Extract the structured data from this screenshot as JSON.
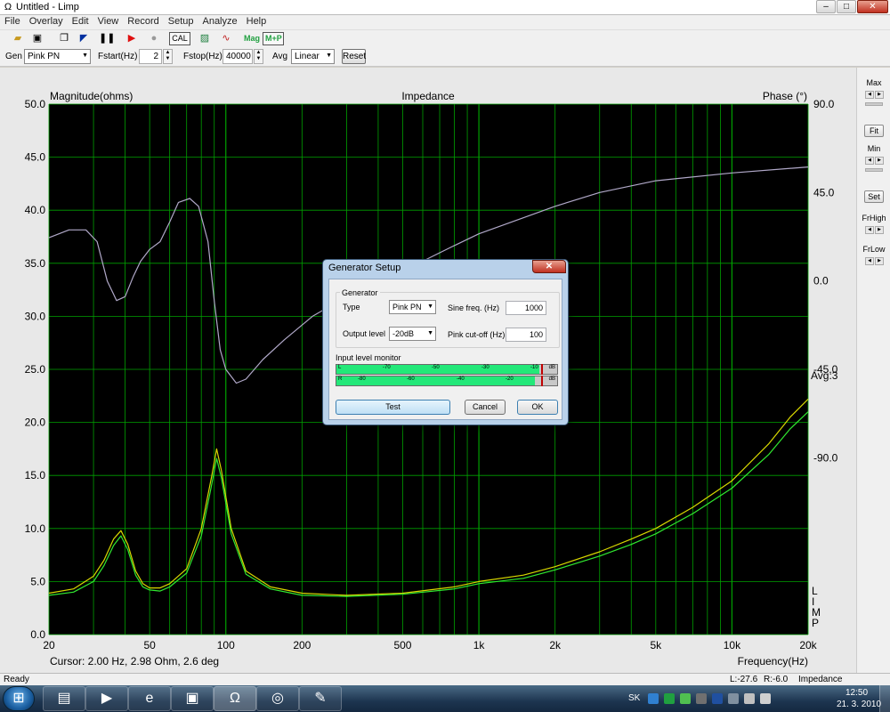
{
  "window": {
    "title": "Untitled - Limp",
    "app_icon": "omega-icon",
    "minimize": "–",
    "restore": "□",
    "close": "✕"
  },
  "menu": [
    "File",
    "Overlay",
    "Edit",
    "View",
    "Record",
    "Setup",
    "Analyze",
    "Help"
  ],
  "toolbar": {
    "cal": "CAL",
    "mag": "Mag",
    "mp": "M+P"
  },
  "genbar": {
    "gen_label": "Gen",
    "gen_value": "Pink PN",
    "fstart_label": "Fstart(Hz)",
    "fstart_value": "2",
    "fstop_label": "Fstop(Hz)",
    "fstop_value": "40000",
    "avg_label": "Avg",
    "avg_value": "Linear",
    "reset": "Reset"
  },
  "chart_data": {
    "type": "line",
    "title": "Impedance",
    "left_label": "Magnitude(ohms)",
    "right_label": "Phase (°)",
    "xlabel": "Frequency(Hz)",
    "x_scale": "log",
    "xlim": [
      20,
      20000
    ],
    "ylim": [
      0,
      50
    ],
    "y2lim": [
      -180,
      90
    ],
    "left_ticks": [
      "50.0",
      "45.0",
      "40.0",
      "35.0",
      "30.0",
      "25.0",
      "20.0",
      "15.0",
      "10.0",
      "5.0",
      "0.0"
    ],
    "right_ticks": [
      "90.0",
      "45.0",
      "0.0",
      "-45.0",
      "-90.0"
    ],
    "x_ticks": [
      {
        "v": 20,
        "t": "20"
      },
      {
        "v": 50,
        "t": "50"
      },
      {
        "v": 100,
        "t": "100"
      },
      {
        "v": 200,
        "t": "200"
      },
      {
        "v": 500,
        "t": "500"
      },
      {
        "v": 1000,
        "t": "1k"
      },
      {
        "v": 2000,
        "t": "2k"
      },
      {
        "v": 5000,
        "t": "5k"
      },
      {
        "v": 10000,
        "t": "10k"
      },
      {
        "v": 20000,
        "t": "20k"
      }
    ],
    "avg_text": "Avg:3",
    "limp_text": [
      "L",
      "I",
      "M",
      "P"
    ],
    "cursor_text": "Cursor: 2.00 Hz, 2.98 Ohm, 2.6 deg",
    "background": "#000000",
    "grid_color": "#00a000",
    "series": [
      {
        "color": "#d8d800",
        "axis": "left",
        "points": [
          [
            20,
            3.9
          ],
          [
            25,
            4.3
          ],
          [
            30,
            5.5
          ],
          [
            33,
            7.0
          ],
          [
            36,
            9.0
          ],
          [
            38.5,
            9.8
          ],
          [
            41,
            8.5
          ],
          [
            44,
            6.0
          ],
          [
            47,
            4.8
          ],
          [
            50,
            4.4
          ],
          [
            55,
            4.4
          ],
          [
            60,
            4.8
          ],
          [
            70,
            6.2
          ],
          [
            80,
            10.0
          ],
          [
            88,
            15.0
          ],
          [
            92,
            17.5
          ],
          [
            96,
            15.5
          ],
          [
            105,
            10.0
          ],
          [
            120,
            6.0
          ],
          [
            150,
            4.5
          ],
          [
            200,
            3.9
          ],
          [
            300,
            3.7
          ],
          [
            500,
            3.9
          ],
          [
            800,
            4.5
          ],
          [
            1000,
            5.0
          ],
          [
            1500,
            5.6
          ],
          [
            2000,
            6.4
          ],
          [
            3000,
            7.8
          ],
          [
            4000,
            9.0
          ],
          [
            5000,
            10.0
          ],
          [
            7000,
            12.0
          ],
          [
            10000,
            14.5
          ],
          [
            14000,
            18.0
          ],
          [
            17000,
            20.5
          ],
          [
            20000,
            22.2
          ]
        ]
      },
      {
        "color": "#30e830",
        "axis": "left",
        "points": [
          [
            20,
            3.7
          ],
          [
            25,
            4.0
          ],
          [
            30,
            5.0
          ],
          [
            33,
            6.5
          ],
          [
            36,
            8.4
          ],
          [
            38.5,
            9.3
          ],
          [
            41,
            8.0
          ],
          [
            44,
            5.6
          ],
          [
            47,
            4.5
          ],
          [
            50,
            4.2
          ],
          [
            55,
            4.1
          ],
          [
            60,
            4.5
          ],
          [
            70,
            5.8
          ],
          [
            80,
            9.3
          ],
          [
            88,
            14.2
          ],
          [
            92,
            16.6
          ],
          [
            96,
            14.8
          ],
          [
            105,
            9.5
          ],
          [
            120,
            5.7
          ],
          [
            150,
            4.3
          ],
          [
            200,
            3.7
          ],
          [
            300,
            3.6
          ],
          [
            500,
            3.8
          ],
          [
            800,
            4.3
          ],
          [
            1000,
            4.8
          ],
          [
            1500,
            5.3
          ],
          [
            2000,
            6.1
          ],
          [
            3000,
            7.4
          ],
          [
            4000,
            8.5
          ],
          [
            5000,
            9.5
          ],
          [
            7000,
            11.4
          ],
          [
            10000,
            13.8
          ],
          [
            14000,
            17.0
          ],
          [
            17000,
            19.4
          ],
          [
            20000,
            21.0
          ]
        ]
      },
      {
        "color": "#b0a8c8",
        "axis": "right",
        "points": [
          [
            20,
            22
          ],
          [
            24,
            26
          ],
          [
            28,
            26
          ],
          [
            31,
            20
          ],
          [
            34,
            0
          ],
          [
            37,
            -10
          ],
          [
            40,
            -8
          ],
          [
            43,
            2
          ],
          [
            46,
            10
          ],
          [
            50,
            16
          ],
          [
            55,
            20
          ],
          [
            60,
            30
          ],
          [
            65,
            40
          ],
          [
            72,
            42
          ],
          [
            78,
            38
          ],
          [
            85,
            20
          ],
          [
            90,
            -10
          ],
          [
            95,
            -35
          ],
          [
            100,
            -45
          ],
          [
            110,
            -52
          ],
          [
            120,
            -50
          ],
          [
            140,
            -40
          ],
          [
            170,
            -30
          ],
          [
            220,
            -18
          ],
          [
            300,
            -8
          ],
          [
            500,
            5
          ],
          [
            800,
            18
          ],
          [
            1000,
            24
          ],
          [
            2000,
            38
          ],
          [
            3000,
            45
          ],
          [
            5000,
            51
          ],
          [
            10000,
            55
          ],
          [
            20000,
            58
          ]
        ]
      }
    ]
  },
  "right_panel": {
    "max": "Max",
    "fit": "Fit",
    "min": "Min",
    "set": "Set",
    "frhigh": "FrHigh",
    "frlow": "FrLow"
  },
  "status": {
    "ready": "Ready",
    "l_value": "L:-27.6",
    "r_value": "R:-6.0",
    "mode": "Impedance Measuremen"
  },
  "taskbar": {
    "lang": "SK",
    "time": "12:50",
    "date": "21. 3. 2010"
  },
  "dialog": {
    "title": "Generator Setup",
    "group_label": "Generator",
    "type_label": "Type",
    "type_value": "Pink PN",
    "sine_label": "Sine freq. (Hz)",
    "sine_value": "1000",
    "output_label": "Output level",
    "output_value": "-20dB",
    "pink_label": "Pink cut-off (Hz)",
    "pink_value": "100",
    "monitor_label": "Input level monitor",
    "l_ch": "L",
    "r_ch": "R",
    "db": "dB",
    "l_ticks": [
      "-70",
      "-50",
      "-30",
      "-10"
    ],
    "r_ticks": [
      "-80",
      "-60",
      "-40",
      "-20"
    ],
    "test": "Test",
    "cancel": "Cancel",
    "ok": "OK"
  }
}
